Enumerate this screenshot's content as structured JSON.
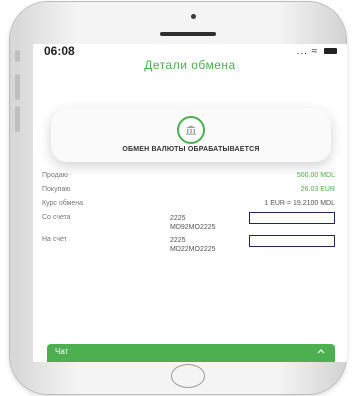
{
  "status_bar": {
    "time": "06:08",
    "signal": "...",
    "wifi": "≈"
  },
  "header": {
    "title": "Детали обмена"
  },
  "status_card": {
    "label": "ОБМЕН ВАЛЮТЫ ОБРАБАТЫВАЕТСЯ"
  },
  "details": {
    "sell": {
      "label": "Продаю",
      "value": "500.00 MDL"
    },
    "buy": {
      "label": "Покупаю",
      "value": "26.03 EUR"
    },
    "rate": {
      "label": "Курс обмена",
      "value": "1 EUR = 19.2100 MDL"
    },
    "from_account": {
      "label": "Со счета",
      "line1": "2225",
      "line2": "MD92MO2225"
    },
    "to_account": {
      "label": "На счет",
      "line1": "2225",
      "line2": "MD22MO2225"
    }
  },
  "chat": {
    "label": "Чат"
  },
  "colors": {
    "accent": "#4caf50",
    "redaction_border": "#1d2a5c"
  }
}
